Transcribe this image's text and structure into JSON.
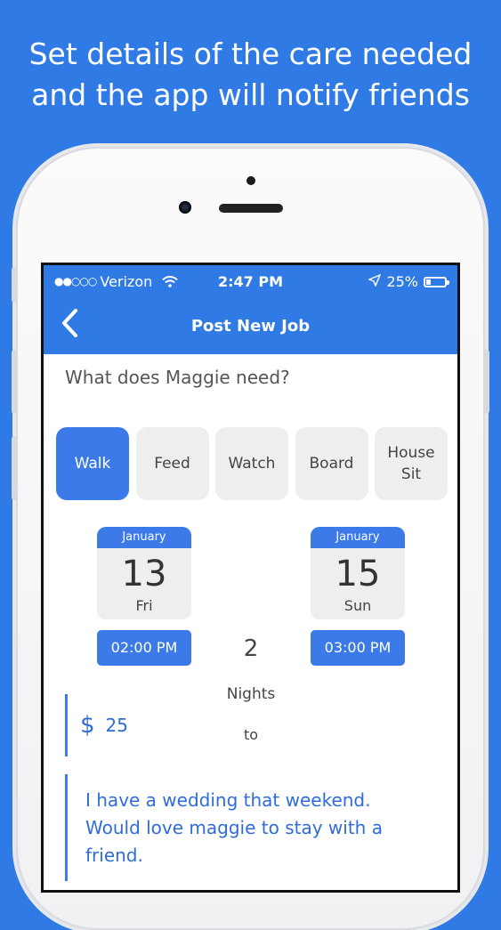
{
  "headline": {
    "line1": "Set details of the care needed",
    "line2": "and the app will notify friends"
  },
  "status_bar": {
    "signal": "●●○○○",
    "carrier": "Verizon",
    "time": "2:47 PM",
    "battery": "25%",
    "battery_level": 0.25
  },
  "nav": {
    "back_icon": "chevron-left-icon",
    "title": "Post New Job"
  },
  "form": {
    "question": "What does Maggie need?",
    "services": [
      {
        "line1": "Walk",
        "line2": "",
        "selected": true
      },
      {
        "line1": "Feed",
        "line2": "",
        "selected": false
      },
      {
        "line1": "Watch",
        "line2": "",
        "selected": false
      },
      {
        "line1": "Board",
        "line2": "",
        "selected": false
      },
      {
        "line1": "House",
        "line2": "Sit",
        "selected": false
      }
    ],
    "start": {
      "month": "January",
      "day": "13",
      "weekday": "Fri",
      "time": "02:00 PM"
    },
    "end": {
      "month": "January",
      "day": "15",
      "weekday": "Sun",
      "time": "03:00 PM"
    },
    "nights": {
      "count": "2",
      "label": "Nights",
      "connector": "to"
    },
    "price": {
      "currency": "$",
      "amount": "25"
    },
    "note": "I have a wedding that weekend. Would love maggie to stay with a friend."
  },
  "colors": {
    "background": "#2f7ae5",
    "accent": "#3b7ae8",
    "text_blue": "#2f6cd8"
  }
}
